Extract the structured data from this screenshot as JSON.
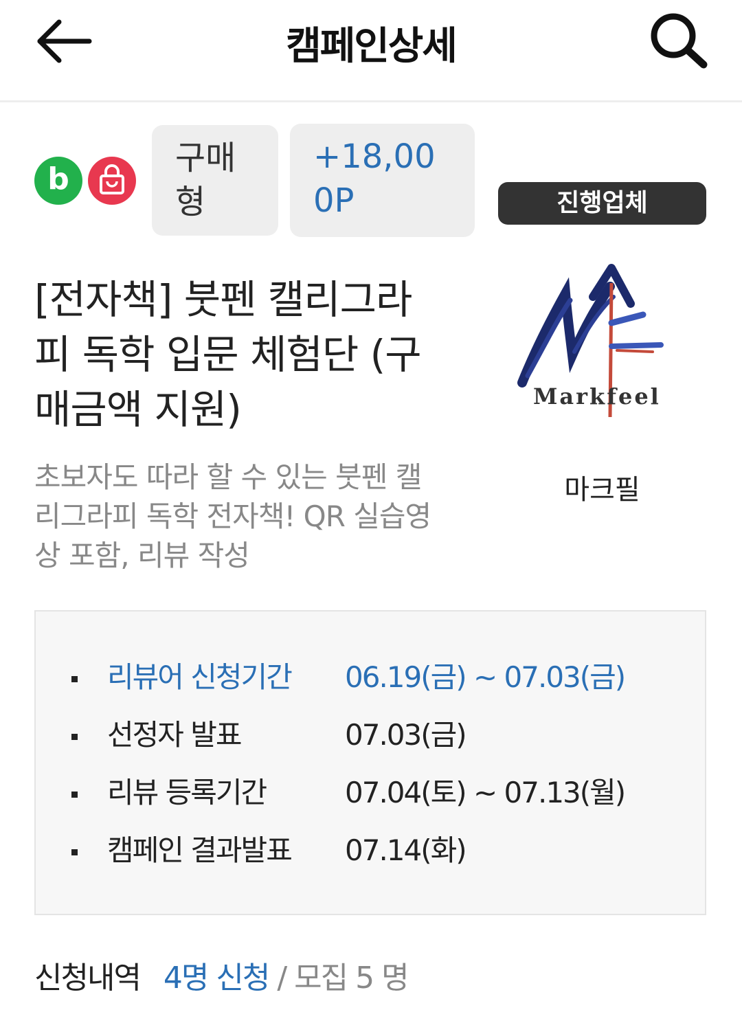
{
  "header": {
    "title": "캠페인상세",
    "back_icon": "arrow-left-icon",
    "search_icon": "search-icon"
  },
  "badges": {
    "blog_letter": "b",
    "blog_color": "#22b14c",
    "shopping_icon": "shopping-bag-icon",
    "shopping_color": "#e8384f"
  },
  "chips": {
    "type_line1": "구매",
    "type_line2": "형",
    "point_line1": "+18,00",
    "point_line2": "0P"
  },
  "vendor": {
    "button_label": "진행업체",
    "logo_text": "Markfeel",
    "name": "마크필"
  },
  "campaign": {
    "title_lines": [
      "[전자책] 붓펜 캘리그라",
      "피 독학 입문 체험단 (구",
      "매금액 지원)"
    ],
    "desc_lines": [
      "초보자도 따라 할 수 있는 붓펜 캘",
      "리그라피 독학 전자책! QR 실습영",
      "상 포함, 리뷰 작성"
    ]
  },
  "schedule": [
    {
      "label": "리뷰어 신청기간",
      "value": "06.19(금) ~ 07.03(금)"
    },
    {
      "label": "선정자 발표",
      "value": "07.03(금)"
    },
    {
      "label": "리뷰 등록기간",
      "value": "07.04(토) ~ 07.13(월)"
    },
    {
      "label": "캠페인 결과발표",
      "value": "07.14(화)"
    }
  ],
  "application": {
    "label": "신청내역",
    "applied": "4명 신청",
    "recruit": " / 모집 5 명"
  },
  "colors": {
    "accent": "#2a6fb5",
    "dark_button": "#333333",
    "chip_bg": "#eeeeee"
  }
}
